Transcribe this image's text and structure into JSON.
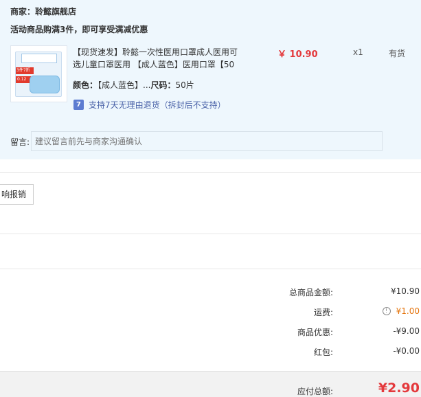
{
  "order": {
    "merchant": "商家：聆懿旗舰店",
    "promo": "活动商品购满3件，即可享受满减优惠",
    "product": {
      "title": "【现货速发】聆懿一次性医用口罩成人医用可选儿童口罩医用 【成人蓝色】医用口罩【50",
      "price": "￥ 10.90",
      "quantity": "x1",
      "stock": "有货",
      "color_label": "颜色：",
      "color_value": "【成人蓝色】...",
      "size_label": "尺码：",
      "size_value": "50片",
      "return_icon": "7",
      "return_policy": "支持7天无理由退货（拆封后不支持）",
      "thumbnail_texts": [
        "3件7折",
        "0.12"
      ]
    },
    "message": {
      "label": "留言:",
      "placeholder": "建议留言前先与商家沟通确认"
    }
  },
  "invoice": {
    "button_label": "响报销"
  },
  "summary": {
    "rows": [
      {
        "label": "总商品金额:",
        "value": "¥10.90"
      },
      {
        "label": "运费:",
        "value": "¥1.00"
      },
      {
        "label": "商品优惠:",
        "value": "-¥9.00"
      },
      {
        "label": "红包:",
        "value": "-¥0.00"
      }
    ],
    "total_label": "应付总额:",
    "total_value": "¥2.90"
  },
  "colors": {
    "price_red": "#e4393c",
    "freight_orange": "#e4730b",
    "card_bg": "#eef7fd",
    "return_blue": "#4a62a8"
  },
  "icons": {
    "return": "seven-day-return-icon",
    "info": "info-icon"
  }
}
